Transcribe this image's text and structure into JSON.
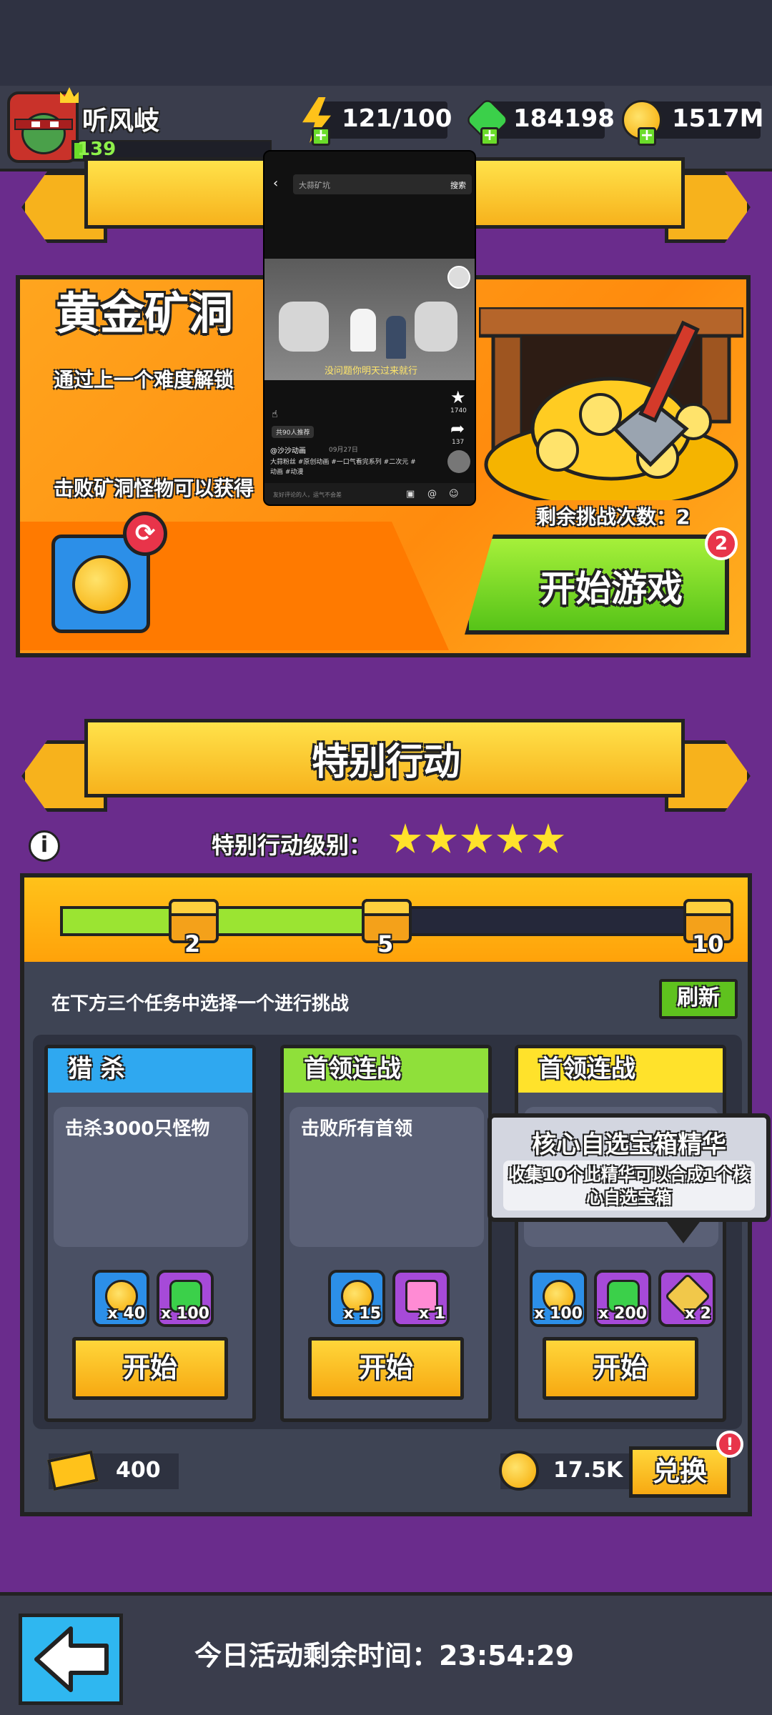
{
  "player": {
    "name": "听风岐",
    "level": "139"
  },
  "resources": {
    "energy": "121/100",
    "gems": "184198",
    "coins": "1517M"
  },
  "gold_mine": {
    "title": "黄金矿洞",
    "desc1": "通过上一个难度解锁",
    "desc2": "击败矿洞怪物可以获得",
    "remaining_challenges": "剩余挑战次数：2",
    "start_button": "开始游戏",
    "start_badge": "2"
  },
  "video_overlay": {
    "search_text": "大蒜矿坑",
    "search_button": "搜索",
    "subtitle": "没问题你明天过来就行",
    "author": "@沙沙动画",
    "date": "09月27日",
    "caption": "大蒜粉丝 #原创动画 #一口气看完系列 #二次元 #动画 #动漫",
    "likes": "1740",
    "shares": "137",
    "recommend": "共90人推荐",
    "comment_placeholder": "友好评论的人，运气不会差"
  },
  "special_action": {
    "title": "特别行动",
    "level_label": "特别行动级别：",
    "stars": 5,
    "progress_fraction": 0.47,
    "milestones": [
      "2",
      "5",
      "10"
    ],
    "instruction": "在下方三个任务中选择一个进行挑战",
    "refresh_label": "刷新",
    "tasks": [
      {
        "title": "猎 杀",
        "desc": "击杀3000只怪物",
        "rewards": [
          {
            "type": "coin",
            "qty": "x 40"
          },
          {
            "type": "gem",
            "qty": "x 100"
          }
        ],
        "start_label": "开始",
        "head_color": "#2fa8f0"
      },
      {
        "title": "首领连战",
        "desc": "击败所有首领",
        "rewards": [
          {
            "type": "coin",
            "qty": "x 15"
          },
          {
            "type": "gift",
            "qty": "x 1"
          }
        ],
        "start_label": "开始",
        "head_color": "#8fe03a"
      },
      {
        "title": "首领连战",
        "desc": "",
        "rewards": [
          {
            "type": "coin",
            "qty": "x 100"
          },
          {
            "type": "gem",
            "qty": "x 200"
          },
          {
            "type": "essence",
            "qty": "x 2"
          }
        ],
        "start_label": "开始",
        "head_color": "#ffe22b"
      }
    ],
    "tooltip": {
      "title": "核心自选宝箱精华",
      "body": "收集10个此精华可以合成1个核心自选宝箱"
    },
    "tickets": "400",
    "coins": "17.5K",
    "exchange_label": "兑换",
    "exchange_badge": "!"
  },
  "footer": {
    "time_label": "今日活动剩余时间：23:54:29"
  }
}
